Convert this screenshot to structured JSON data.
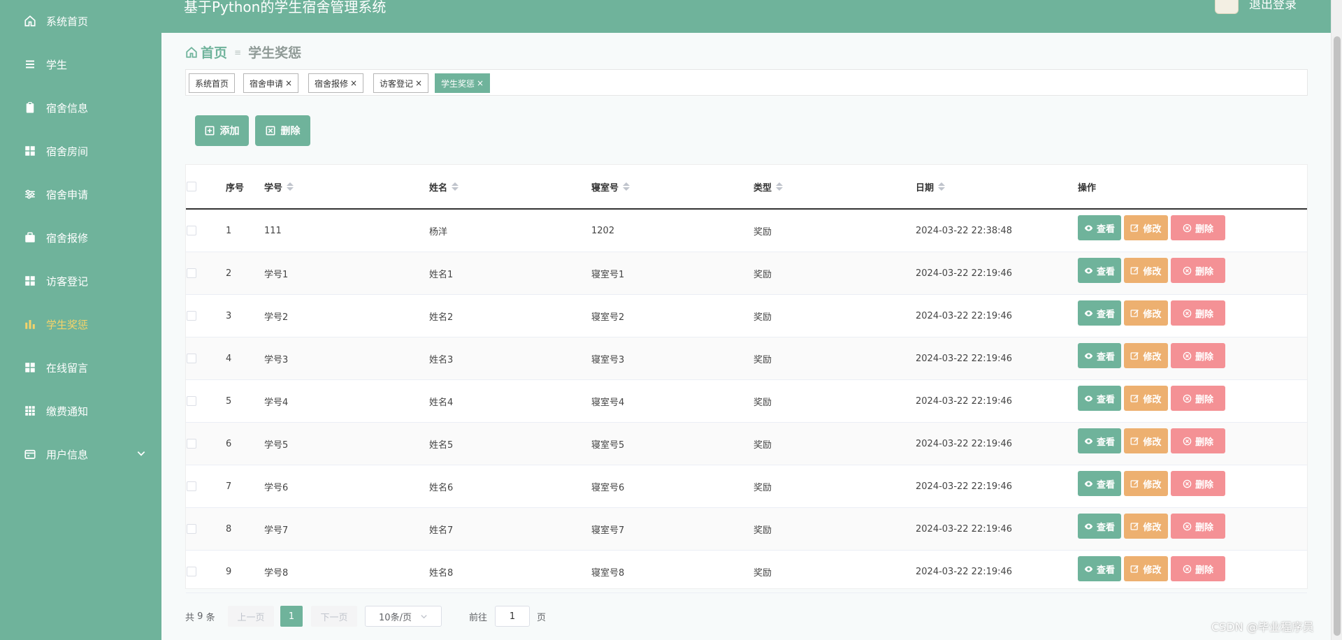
{
  "app_title": "基于Python的学生宿舍管理系统",
  "logout_label": "退出登录",
  "sidebar": {
    "items": [
      {
        "label": "系统首页",
        "icon": "home-icon"
      },
      {
        "label": "学生",
        "icon": "list-icon"
      },
      {
        "label": "宿舍信息",
        "icon": "clipboard-icon"
      },
      {
        "label": "宿舍房间",
        "icon": "grid-icon"
      },
      {
        "label": "宿舍申请",
        "icon": "sliders-icon"
      },
      {
        "label": "宿舍报修",
        "icon": "briefcase-icon"
      },
      {
        "label": "访客登记",
        "icon": "grid-icon"
      },
      {
        "label": "学生奖惩",
        "icon": "chart-icon",
        "active": true
      },
      {
        "label": "在线留言",
        "icon": "grid-icon"
      },
      {
        "label": "缴费通知",
        "icon": "grid-small-icon"
      },
      {
        "label": "用户信息",
        "icon": "card-icon",
        "has_submenu": true
      }
    ]
  },
  "breadcrumb": {
    "home": "首页",
    "separator": "≡",
    "current": "学生奖惩"
  },
  "tags": [
    {
      "label": "系统首页",
      "closable": false
    },
    {
      "label": "宿舍申请",
      "closable": true
    },
    {
      "label": "宿舍报修",
      "closable": true
    },
    {
      "label": "访客登记",
      "closable": true
    },
    {
      "label": "学生奖惩",
      "closable": true,
      "active": true
    }
  ],
  "tag_close": "×",
  "toolbar": {
    "add_label": "添加",
    "delete_label": "删除"
  },
  "table": {
    "columns": {
      "index": "序号",
      "student_id": "学号",
      "name": "姓名",
      "room": "寝室号",
      "type": "类型",
      "date": "日期",
      "actions": "操作"
    },
    "rows": [
      {
        "index": "1",
        "student_id": "111",
        "name": "杨洋",
        "room": "1202",
        "type": "奖励",
        "date": "2024-03-22 22:38:48"
      },
      {
        "index": "2",
        "student_id": "学号1",
        "name": "姓名1",
        "room": "寝室号1",
        "type": "奖励",
        "date": "2024-03-22 22:19:46"
      },
      {
        "index": "3",
        "student_id": "学号2",
        "name": "姓名2",
        "room": "寝室号2",
        "type": "奖励",
        "date": "2024-03-22 22:19:46"
      },
      {
        "index": "4",
        "student_id": "学号3",
        "name": "姓名3",
        "room": "寝室号3",
        "type": "奖励",
        "date": "2024-03-22 22:19:46"
      },
      {
        "index": "5",
        "student_id": "学号4",
        "name": "姓名4",
        "room": "寝室号4",
        "type": "奖励",
        "date": "2024-03-22 22:19:46"
      },
      {
        "index": "6",
        "student_id": "学号5",
        "name": "姓名5",
        "room": "寝室号5",
        "type": "奖励",
        "date": "2024-03-22 22:19:46"
      },
      {
        "index": "7",
        "student_id": "学号6",
        "name": "姓名6",
        "room": "寝室号6",
        "type": "奖励",
        "date": "2024-03-22 22:19:46"
      },
      {
        "index": "8",
        "student_id": "学号7",
        "name": "姓名7",
        "room": "寝室号7",
        "type": "奖励",
        "date": "2024-03-22 22:19:46"
      },
      {
        "index": "9",
        "student_id": "学号8",
        "name": "姓名8",
        "room": "寝室号8",
        "type": "奖励",
        "date": "2024-03-22 22:19:46"
      }
    ],
    "actions": {
      "view": "查看",
      "edit": "修改",
      "delete": "删除"
    }
  },
  "pagination": {
    "total_prefix": "共",
    "total": "9",
    "total_suffix": "条",
    "prev": "上一页",
    "current_page": "1",
    "next": "下一页",
    "page_size": "10条/页",
    "goto_prefix": "前往",
    "goto_value": "1",
    "goto_suffix": "页"
  },
  "watermark": "CSDN @毕业程序员",
  "colors": {
    "primary": "#6fb39b",
    "edit": "#edb070",
    "delete": "#f49195",
    "active_menu": "#f5d36a"
  }
}
